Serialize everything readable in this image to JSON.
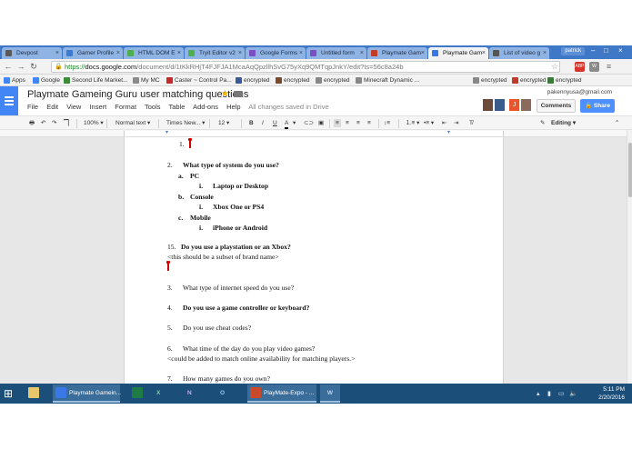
{
  "browser": {
    "tabs": [
      {
        "label": "Devpost",
        "color": "#5a5a5a",
        "active": false
      },
      {
        "label": "Gamer Profile",
        "color": "#3a7bd5",
        "active": false
      },
      {
        "label": "HTML DOM E",
        "color": "#4caf50",
        "active": false
      },
      {
        "label": "Tryit Editor v2",
        "color": "#4caf50",
        "active": false
      },
      {
        "label": "Google Forms",
        "color": "#7b4fc3",
        "active": false
      },
      {
        "label": "Untitled form",
        "color": "#7b4fc3",
        "active": false
      },
      {
        "label": "Playmate Gam",
        "color": "#c23b22",
        "active": false
      },
      {
        "label": "Playmate Gam",
        "color": "#3b78e7",
        "active": true
      },
      {
        "label": "List of video g",
        "color": "#555555",
        "active": false
      }
    ],
    "profile": "patrick",
    "url_secure": "https://",
    "url_host": "docs.google.com",
    "url_rest": "/document/d/1tKkRHjT4FJFJA1McaAqQpzllhSvG75yXq9QMTqpJnkY/edit?ts=56c8a24b",
    "extensions": [
      {
        "label": "ABP",
        "color": "#d8342b"
      },
      {
        "label": "W",
        "color": "#8a8a8a"
      },
      {
        "label": "≡",
        "color": "#6d6d6d"
      }
    ]
  },
  "bookmarks": [
    {
      "label": "Apps",
      "color": "#4285f4"
    },
    {
      "label": "Google",
      "color": "#4285f4"
    },
    {
      "label": "Second Life Market...",
      "color": "#3c8c3c"
    },
    {
      "label": "My MC",
      "color": "#8a8a8a"
    },
    {
      "label": "Caster ~ Control Pa...",
      "color": "#c62828"
    },
    {
      "label": "encrypted",
      "color": "#3b5998"
    },
    {
      "label": "encrypted",
      "color": "#7a4a2a"
    },
    {
      "label": "encrypted",
      "color": "#888888"
    },
    {
      "label": "Minecraft Dynamic ...",
      "color": "#888888"
    },
    {
      "label": "encrypted",
      "color": "#888888"
    },
    {
      "label": "encrypted",
      "color": "#c0392b"
    },
    {
      "label": "encrypted",
      "color": "#3b7a3b"
    }
  ],
  "docs": {
    "title": "Playmate Gameing Guru user matching questions",
    "menu": [
      "File",
      "Edit",
      "View",
      "Insert",
      "Format",
      "Tools",
      "Table",
      "Add-ons",
      "Help"
    ],
    "save_status": "All changes saved in Drive",
    "user_email": "pakennyusa@gmail.com",
    "comments_label": "Comments",
    "share_label": "Share",
    "toolbar": {
      "zoom": "100%",
      "style": "Normal text",
      "font": "Times New...",
      "size": "12",
      "bold": "B",
      "italic": "I",
      "underline": "U",
      "text_color": "A",
      "mode": "Editing"
    }
  },
  "document": {
    "lines": [
      {
        "text": "1.",
        "bold": false
      },
      {
        "text": "2.",
        "bold": false
      },
      {
        "text": "What type of system do you use?",
        "bold": true
      },
      {
        "text": "a.",
        "bold": true
      },
      {
        "text": "PC",
        "bold": true
      },
      {
        "text": "i.",
        "bold": true
      },
      {
        "text": "Laptop or Desktop",
        "bold": true
      },
      {
        "text": "b.",
        "bold": true
      },
      {
        "text": "Console",
        "bold": true
      },
      {
        "text": "i.",
        "bold": true
      },
      {
        "text": "Xbox One or PS4",
        "bold": true
      },
      {
        "text": "c.",
        "bold": true
      },
      {
        "text": "Mobile",
        "bold": true
      },
      {
        "text": "i.",
        "bold": true
      },
      {
        "text": "iPhone or Android",
        "bold": true
      },
      {
        "text": "15.",
        "bold": false
      },
      {
        "text": "Do you use a playstation or an Xbox?",
        "bold": true
      },
      {
        "text": "<this should be a subset of brand name>",
        "bold": false
      },
      {
        "text": "3.",
        "bold": false
      },
      {
        "text": "What type of internet speed do you use?",
        "bold": false
      },
      {
        "text": "4.",
        "bold": false
      },
      {
        "text": "Do you use a game controller or keyboard?",
        "bold": true
      },
      {
        "text": "5.",
        "bold": false
      },
      {
        "text": "Do you use cheat codes?",
        "bold": false
      },
      {
        "text": "6.",
        "bold": false
      },
      {
        "text": "What time of the day do you play video games?",
        "bold": false
      },
      {
        "text": "<could be added to match online availability for matching players.>",
        "bold": false
      },
      {
        "text": "7.",
        "bold": false
      },
      {
        "text": "How many games do you own?",
        "bold": false
      }
    ]
  },
  "taskbar": {
    "items": [
      {
        "label": "",
        "color": "#e8c66b"
      },
      {
        "label": "Playmate Gamein...",
        "color": "#3b78e7"
      },
      {
        "label": "",
        "color": "#1e7b45"
      },
      {
        "label": "X",
        "color": "#1e7b45"
      },
      {
        "label": "N",
        "color": "#7b3fa0"
      },
      {
        "label": "O",
        "color": "#1e5fa8"
      },
      {
        "label": "PlayMate-Expo - ...",
        "color": "#c94a2a"
      },
      {
        "label": "W",
        "color": "#2b5797"
      }
    ],
    "time": "5:11 PM",
    "date": "2/20/2016"
  }
}
